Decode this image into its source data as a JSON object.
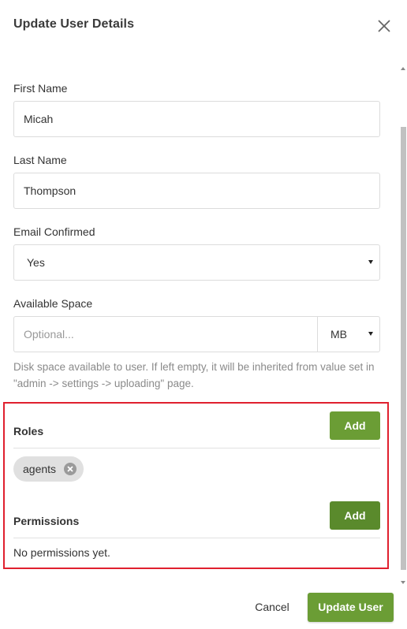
{
  "dialog": {
    "title": "Update User Details",
    "close_icon": "close-icon"
  },
  "form": {
    "first_name": {
      "label": "First Name",
      "value": "Micah"
    },
    "last_name": {
      "label": "Last Name",
      "value": "Thompson"
    },
    "email_confirmed": {
      "label": "Email Confirmed",
      "value": "Yes"
    },
    "available_space": {
      "label": "Available Space",
      "placeholder": "Optional...",
      "unit": "MB",
      "help": "Disk space available to user. If left empty, it will be inherited from value set in \"admin -> settings -> uploading\" page."
    }
  },
  "roles": {
    "title": "Roles",
    "add_label": "Add",
    "items": [
      {
        "label": "agents"
      }
    ]
  },
  "permissions": {
    "title": "Permissions",
    "add_label": "Add",
    "empty_text": "No permissions yet."
  },
  "footer": {
    "cancel_label": "Cancel",
    "submit_label": "Update User"
  },
  "colors": {
    "accent": "#6b9d35",
    "highlight": "#e0202e"
  }
}
